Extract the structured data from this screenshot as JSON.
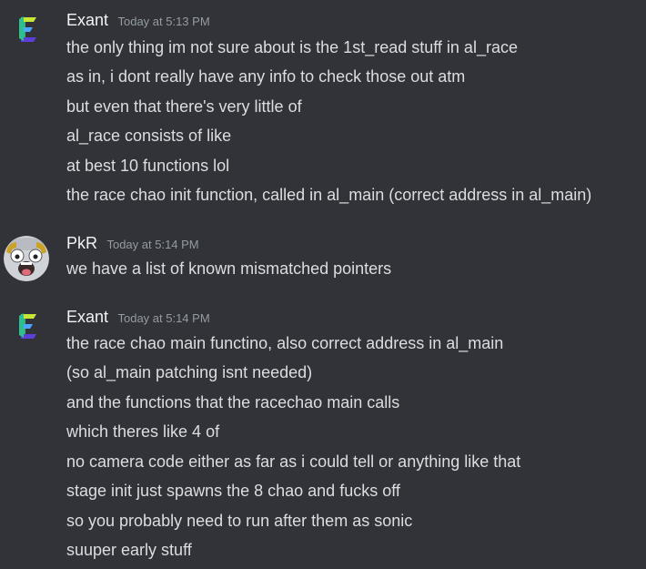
{
  "messages": [
    {
      "author": "Exant",
      "timestamp": "Today at 5:13 PM",
      "avatar_icon": "exant-logo-icon",
      "lines": [
        "the only thing im not sure about is the 1st_read stuff in al_race",
        "as in, i dont really have any info to check those out atm",
        "but even that there's very little of",
        "al_race consists of like",
        "at best 10 functions lol",
        "the race chao init function, called in al_main (correct address in al_main)"
      ]
    },
    {
      "author": "PkR",
      "timestamp": "Today at 5:14 PM",
      "avatar_icon": "chao-face-avatar-icon",
      "lines": [
        "we have a list of known mismatched pointers"
      ]
    },
    {
      "author": "Exant",
      "timestamp": "Today at 5:14 PM",
      "avatar_icon": "exant-logo-icon",
      "lines": [
        "the race chao main functino, also correct address in al_main",
        "(so al_main patching isnt needed)",
        "and the functions that the racechao main calls",
        "which theres like 4 of",
        "no camera code either as far as i could tell or anything like that",
        "stage init just spawns the 8 chao and fucks off",
        "so you probably need to run after them as sonic",
        "suuper early stuff"
      ]
    }
  ],
  "colors": {
    "background": "#313338",
    "username": "#f2f3f5",
    "timestamp": "#949ba4",
    "message_text": "#dbdee1"
  }
}
